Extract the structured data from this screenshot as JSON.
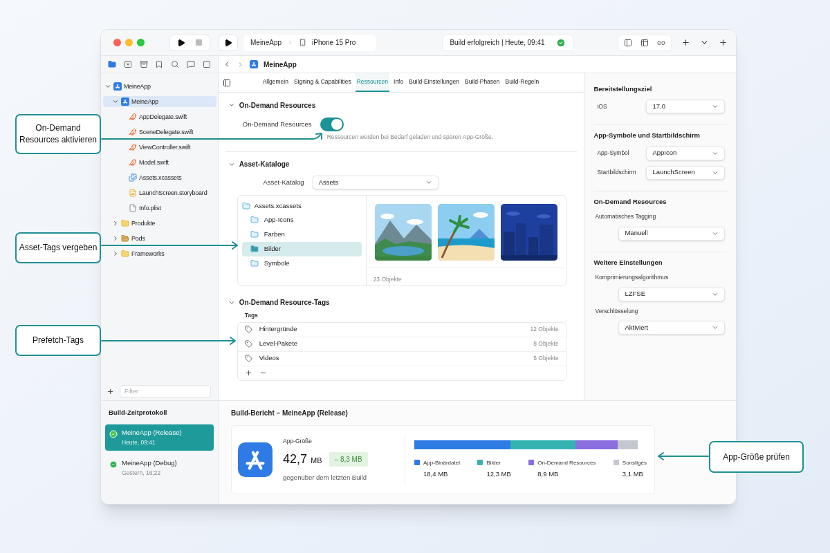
{
  "toolbar": {
    "scheme": "MeineApp",
    "device": "iPhone 15 Pro",
    "status": "Build erfolgreich | Heute, 09:41"
  },
  "breadcrumb": {
    "item": "MeineApp"
  },
  "navigator": {
    "tree": [
      {
        "label": "MeineApp",
        "kind": "project",
        "expanded": true,
        "selected": false,
        "children": [
          {
            "label": "MeineApp",
            "kind": "project",
            "expanded": true,
            "selected": true,
            "children": [
              {
                "label": "AppDelegate.swift",
                "kind": "swift",
                "selected": false
              },
              {
                "label": "SceneDelegate.swift",
                "kind": "swift",
                "selected": false
              },
              {
                "label": "ViewController.swift",
                "kind": "swift",
                "selected": false
              },
              {
                "label": "Model.swift",
                "kind": "swift",
                "selected": false
              },
              {
                "label": "Assets.xcassets",
                "kind": "assets",
                "selected": false
              },
              {
                "label": "LaunchScreen.storyboard",
                "kind": "storyboard",
                "selected": false
              },
              {
                "label": "Info.plist",
                "kind": "plist",
                "selected": false
              }
            ]
          },
          {
            "label": "Produkte",
            "kind": "folder",
            "expanded": false,
            "selected": false
          },
          {
            "label": "Pods",
            "kind": "pods",
            "expanded": false,
            "selected": false
          },
          {
            "label": "Frameworks",
            "kind": "folder",
            "expanded": false,
            "selected": false
          }
        ]
      }
    ],
    "filter_placeholder": "Filter"
  },
  "tabs": [
    {
      "label": "Allgemein",
      "selected": false
    },
    {
      "label": "Signing & Capabilities",
      "selected": false
    },
    {
      "label": "Ressourcen",
      "selected": true
    },
    {
      "label": "Info",
      "selected": false
    },
    {
      "label": "Build-Einstellungen",
      "selected": false
    },
    {
      "label": "Build-Phasen",
      "selected": false
    },
    {
      "label": "Build-Regeln",
      "selected": false
    }
  ],
  "on_demand": {
    "title": "On-Demand Resources",
    "expanded": true,
    "label": "On-Demand Resources",
    "on": true,
    "hint": "Ressourcen werden bei Bedarf geladen und sparen App-Größe."
  },
  "asset_catalogs": {
    "title": "Asset-Kataloge",
    "expanded": true,
    "label": "Asset-Katalog",
    "value": "Assets",
    "tree": {
      "label": "Assets.xcassets",
      "children": [
        {
          "label": "App-Icons",
          "selected": false
        },
        {
          "label": "Farben",
          "selected": false
        },
        {
          "label": "Bilder",
          "selected": true
        },
        {
          "label": "Symbole",
          "selected": false
        }
      ]
    },
    "count": "23 Objekte"
  },
  "resource_tags": {
    "title": "On-Demand Resource-Tags",
    "expanded": true,
    "column": "Tags",
    "tags": [
      {
        "name": "Hintergründe",
        "count": "12 Objekte"
      },
      {
        "name": "Level-Pakete",
        "count": "8 Objekte"
      },
      {
        "name": "Videos",
        "count": "5 Objekte"
      }
    ]
  },
  "inspector": [
    {
      "title": "Bereitstellungsziel",
      "fields": [
        {
          "kind": "inline",
          "label": "iOS",
          "value": "17.0"
        }
      ]
    },
    {
      "title": "App-Symbole und Startbildschirm",
      "fields": [
        {
          "kind": "inline",
          "label": "App-Symbol",
          "value": "AppIcon"
        },
        {
          "kind": "inline",
          "label": "Startbildschirm",
          "value": "LaunchScreen"
        }
      ]
    },
    {
      "title": "On-Demand Resources",
      "fields": [
        {
          "kind": "stacked",
          "label": "Automatisches Tagging",
          "value": "Manuell"
        }
      ]
    },
    {
      "title": "Weitere Einstellungen",
      "fields": [
        {
          "kind": "stacked",
          "label": "Komprimierungsalgorithmus",
          "value": "LZFSE"
        },
        {
          "kind": "stacked",
          "label": "Verschlüsselung",
          "value": "Aktiviert"
        }
      ]
    }
  ],
  "build_log": {
    "title": "Build-Zeitprotokoll",
    "builds": [
      {
        "name": "MeineApp (Release)",
        "time": "Heute, 09:41",
        "selected": true
      },
      {
        "name": "MeineApp (Debug)",
        "time": "Gestern, 16:22",
        "selected": false
      }
    ]
  },
  "report": {
    "title": "Build-Bericht – MeineApp (Release)",
    "label": "App-Größe",
    "size": "42,7",
    "unit": "MB",
    "delta": "– 8,3 MB",
    "note": "gegenüber dem letzten Build",
    "segments": [
      {
        "name": "App-Binärdatei",
        "value": "18,4 MB",
        "color": "#2f7be6"
      },
      {
        "name": "Bilder",
        "value": "12,3 MB",
        "color": "#35b3b3"
      },
      {
        "name": "On-Demand Resources",
        "value": "8,9 MB",
        "color": "#8b6ee0"
      },
      {
        "name": "Sonstiges",
        "value": "3,1 MB",
        "color": "#c4c8ce"
      }
    ]
  },
  "callouts": [
    {
      "text": "On-Demand Resources aktivieren"
    },
    {
      "text": "Asset-Tags vergeben"
    },
    {
      "text": "Prefetch-Tags"
    },
    {
      "text": "App-Größe prüfen"
    }
  ]
}
